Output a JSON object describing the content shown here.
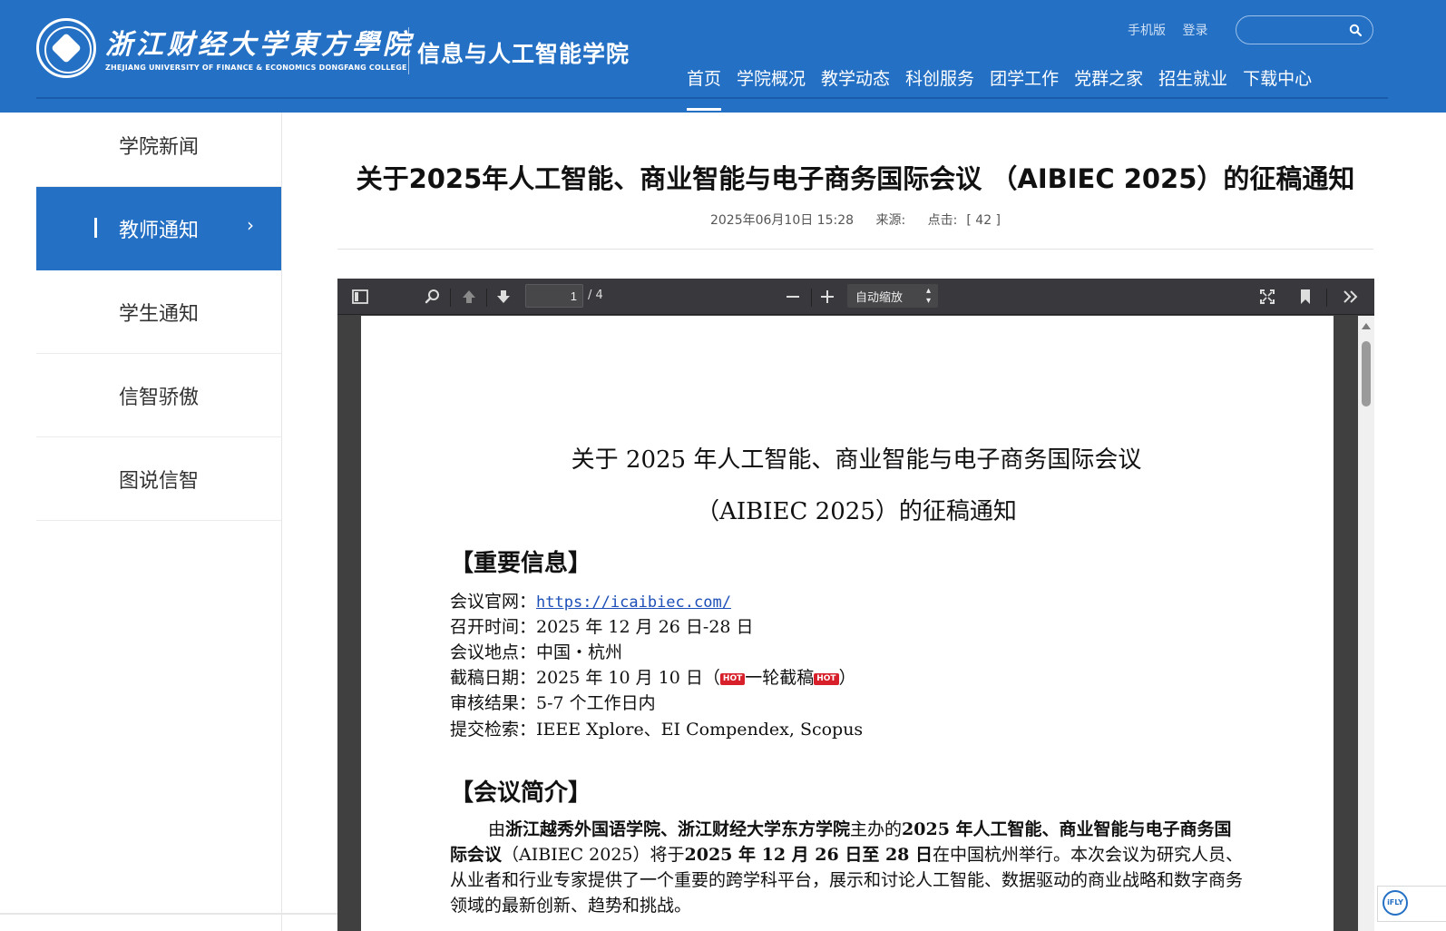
{
  "header": {
    "school_name": "浙江财经大学東方學院",
    "school_name_en": "ZHEJIANG UNIVERSITY OF FINANCE & ECONOMICS DONGFANG COLLEGE",
    "college_name": "信息与人工智能学院",
    "top_links": [
      "手机版",
      "登录"
    ],
    "search": {
      "value": "",
      "placeholder": ""
    },
    "nav": [
      "首页",
      "学院概况",
      "教学动态",
      "科创服务",
      "团学工作",
      "党群之家",
      "招生就业",
      "下载中心"
    ],
    "active_nav": "首页"
  },
  "sidebar": {
    "items": [
      {
        "label": "学院新闻",
        "active": false
      },
      {
        "label": "教师通知",
        "active": true
      },
      {
        "label": "学生通知",
        "active": false
      },
      {
        "label": "信智骄傲",
        "active": false
      },
      {
        "label": "图说信智",
        "active": false
      }
    ]
  },
  "article": {
    "title": "关于2025年人工智能、商业智能与电子商务国际会议 （AIBIEC 2025）的征稿通知",
    "date": "2025年06月10日 15:28",
    "source_label": "来源:",
    "clicks_label": "点击:",
    "clicks": "[ 42 ]"
  },
  "pdf_viewer": {
    "current_page": "1",
    "total_pages": "/ 4",
    "zoom": "自动缩放",
    "icons": [
      "sidebar-toggle-icon",
      "search-icon",
      "page-up-icon",
      "page-down-icon",
      "zoom-out-icon",
      "zoom-in-icon",
      "fullscreen-icon",
      "bookmark-icon",
      "more-tools-icon"
    ]
  },
  "document": {
    "title_line1": "关于 2025 年人工智能、商业智能与电子商务国际会议",
    "title_line2": "（AIBIEC 2025）的征稿通知",
    "section1": "【重要信息】",
    "info": {
      "website_label": "会议官网：",
      "website_url": "https://icaibiec.com/",
      "time": "召开时间：2025 年 12 月 26 日-28 日",
      "location": "会议地点：中国・杭州",
      "deadline_prefix": "截稿日期：2025 年 10 月 10 日（",
      "hot_badge": "HOT",
      "deadline_mid": "一轮截稿",
      "deadline_suffix": "）",
      "review": "审核结果：5-7 个工作日内",
      "index": "提交检索：IEEE Xplore、EI Compendex, Scopus"
    },
    "section2": "【会议简介】",
    "intro": {
      "p1_pre": "由",
      "p1_bold1": "浙江越秀外国语学院、浙江财经大学东方学院",
      "p1_mid": "主办的",
      "p1_bold2": "2025 年人工智能、商业智能与电子商务国际会议",
      "p1_mid2": "（AIBIEC 2025）将于",
      "p1_bold3": "2025 年 12 月 26 日至 28 日",
      "p1_rest": "在中国杭州举行。本次会议为研究人员、从业者和行业专家提供了一个重要的跨学科平台，展示和讨论人工智能、数据驱动的商业战略和数字商务领域的最新创新、趋势和挑战。"
    }
  },
  "widget": {
    "label": "iFLY"
  },
  "colors": {
    "primary": "#2470c4",
    "toolbar": "#38383d",
    "viewer_bg": "#404040",
    "hot": "#d8202a"
  }
}
